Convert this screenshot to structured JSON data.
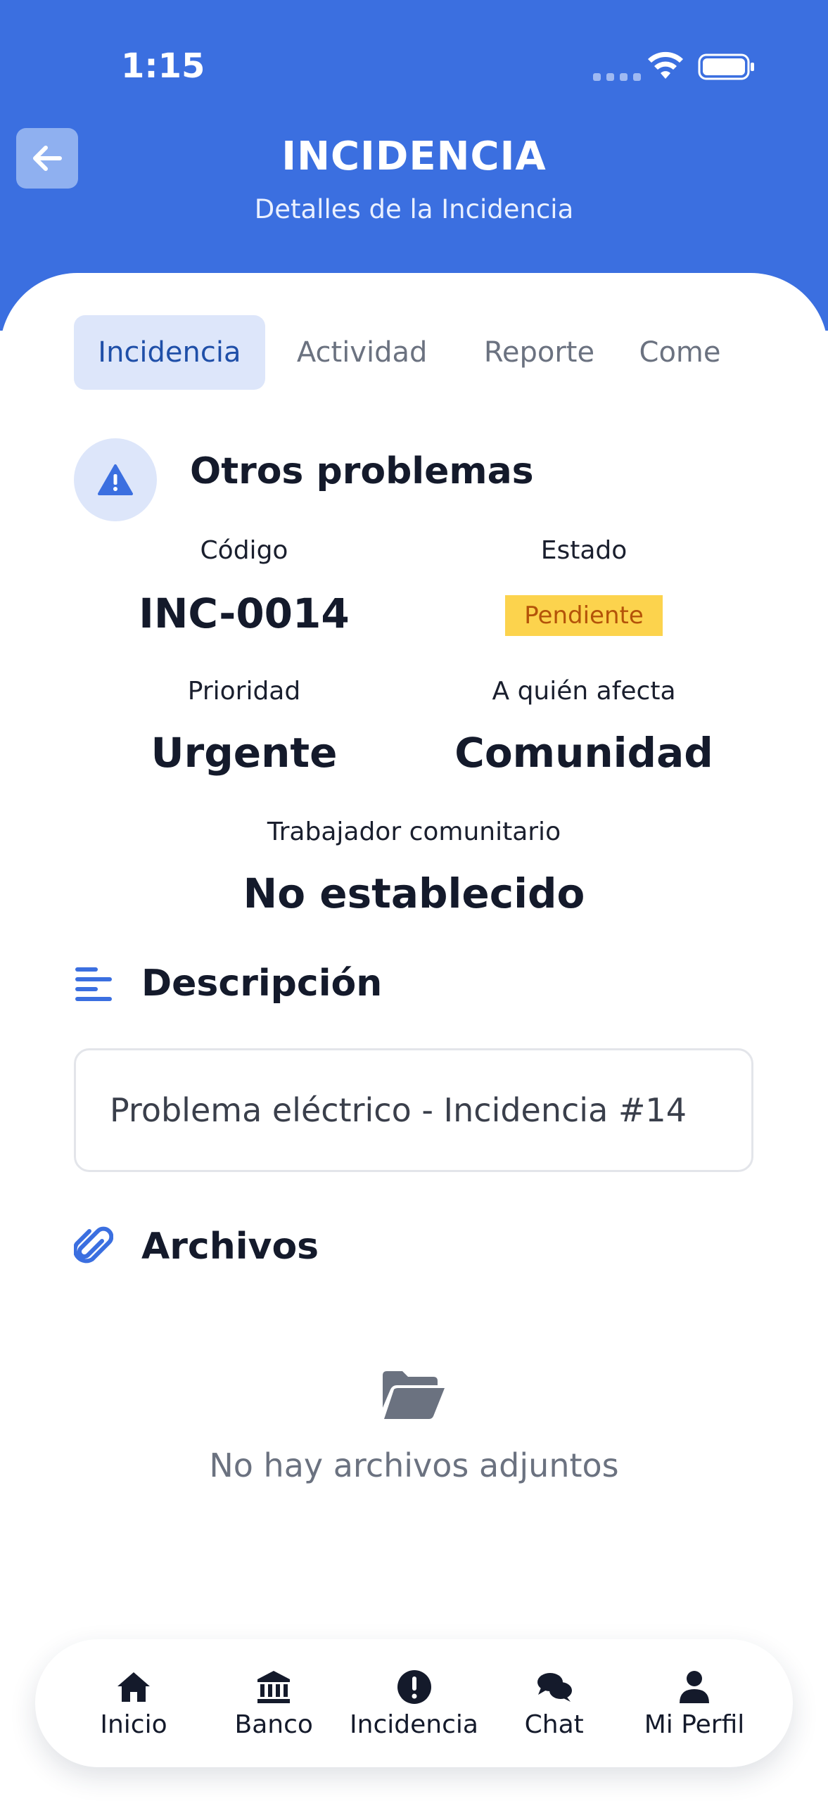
{
  "status_bar": {
    "time": "1:15"
  },
  "header": {
    "title": "INCIDENCIA",
    "subtitle": "Detalles de la Incidencia",
    "background": "#3b6fe0"
  },
  "tabs": [
    {
      "label": "Incidencia",
      "active": true
    },
    {
      "label": "Actividad",
      "active": false
    },
    {
      "label": "Reporte",
      "active": false
    },
    {
      "label": "Come",
      "active": false
    }
  ],
  "incident": {
    "category_icon": "warning-icon",
    "category": "Otros problemas",
    "code_label": "Código",
    "code": "INC-0014",
    "status_label": "Estado",
    "status": "Pendiente",
    "status_color": "#fcd34d",
    "priority_label": "Prioridad",
    "priority": "Urgente",
    "affects_label": "A quién afecta",
    "affects": "Comunidad",
    "worker_label": "Trabajador comunitario",
    "worker": "No establecido"
  },
  "description": {
    "icon": "lines-icon",
    "title": "Descripción",
    "text": "Problema eléctrico - Incidencia #14"
  },
  "files": {
    "icon": "paperclip-icon",
    "title": "Archivos",
    "empty_icon": "folder-open-icon",
    "empty_text": "No hay archivos adjuntos"
  },
  "bottom_nav": [
    {
      "label": "Inicio",
      "icon": "home-icon"
    },
    {
      "label": "Banco",
      "icon": "bank-icon"
    },
    {
      "label": "Incidencia",
      "icon": "alert-circle-icon"
    },
    {
      "label": "Chat",
      "icon": "chat-icon"
    },
    {
      "label": "Mi Perfil",
      "icon": "user-icon"
    }
  ],
  "accent_color": "#3b6fe0"
}
